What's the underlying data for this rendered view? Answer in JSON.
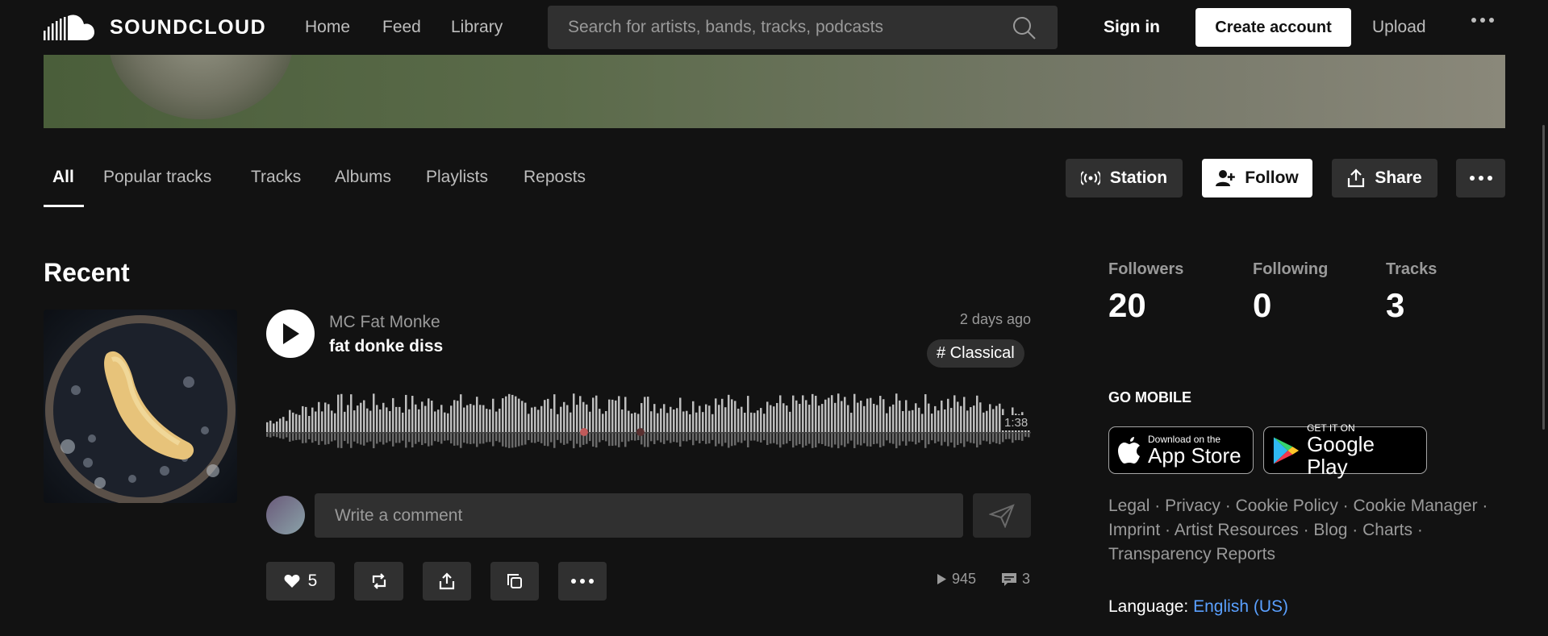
{
  "header": {
    "logo_text": "SOUNDCLOUD",
    "nav": [
      "Home",
      "Feed",
      "Library"
    ],
    "search_placeholder": "Search for artists, bands, tracks, podcasts",
    "sign_in": "Sign in",
    "create_account": "Create account",
    "upload": "Upload"
  },
  "profile_tabs": [
    "All",
    "Popular tracks",
    "Tracks",
    "Albums",
    "Playlists",
    "Reposts"
  ],
  "profile_actions": {
    "station": "Station",
    "follow": "Follow",
    "share": "Share"
  },
  "recent": {
    "title": "Recent",
    "track": {
      "artist": "MC Fat Monke",
      "title": "fat donke diss",
      "posted": "2 days ago",
      "tag": "# Classical",
      "duration": "1:38",
      "likes": "5",
      "plays": "945",
      "comments": "3"
    },
    "comment_placeholder": "Write a comment"
  },
  "stats": [
    {
      "label": "Followers",
      "value": "20"
    },
    {
      "label": "Following",
      "value": "0"
    },
    {
      "label": "Tracks",
      "value": "3"
    }
  ],
  "go_mobile": {
    "title": "GO MOBILE",
    "app_store_small": "Download on the",
    "app_store_big": "App Store",
    "google_small": "GET IT ON",
    "google_big": "Google Play"
  },
  "footer": {
    "links": [
      "Legal",
      "Privacy",
      "Cookie Policy",
      "Cookie Manager",
      "Imprint",
      "Artist Resources",
      "Blog",
      "Charts",
      "Transparency Reports"
    ],
    "language_label": "Language:",
    "language_value": "English (US)"
  }
}
